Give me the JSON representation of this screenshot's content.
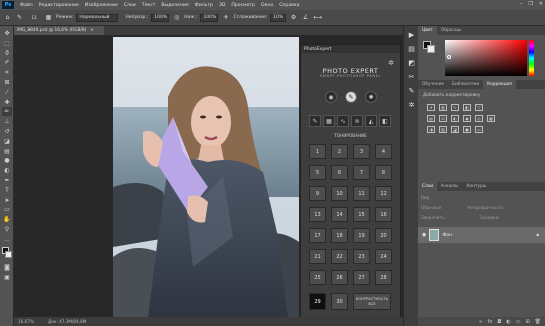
{
  "app": {
    "logo": "Ps",
    "menu": [
      "Файл",
      "Редактирование",
      "Изображение",
      "Слои",
      "Текст",
      "Выделение",
      "Фильтр",
      "3D",
      "Просмотр",
      "Окно",
      "Справка"
    ],
    "window_controls": [
      "–",
      "❐",
      "✕"
    ]
  },
  "options": {
    "mode_label": "Режим:",
    "mode_value": "Нормальный",
    "opacity_label": "Непрозр.:",
    "opacity_value": "100%",
    "flow_label": "Наж.:",
    "flow_value": "100%",
    "smooth_label": "Сглаживание:",
    "smooth_value": "10%",
    "brush_size": "13"
  },
  "document": {
    "tab_title": "IMG_8849.psd @ 16,6% (RGB/8)",
    "tab_close": "×",
    "zoom": "16,67%",
    "doc_info": "Док: 47,3M/84,8M"
  },
  "tools": [
    "move-icon",
    "marquee-icon",
    "lasso-icon",
    "quick-select-icon",
    "crop-icon",
    "frame-icon",
    "eyedropper-icon",
    "healing-icon",
    "brush-icon",
    "stamp-icon",
    "history-brush-icon",
    "eraser-icon",
    "gradient-icon",
    "blur-icon",
    "dodge-icon",
    "pen-icon",
    "type-icon",
    "path-select-icon",
    "shape-icon",
    "hand-icon",
    "zoom-icon",
    "more-icon"
  ],
  "plugin": {
    "title": "PhotoExpert",
    "logo_line1": "PHOTO EXPERT",
    "logo_line2": "SMART PHOTOSHOP PANEL",
    "section_label": "ТОНИРОВАНИЕ",
    "numbers": [
      "1",
      "2",
      "3",
      "4",
      "5",
      "6",
      "7",
      "8",
      "9",
      "10",
      "11",
      "12",
      "13",
      "14",
      "15",
      "16",
      "17",
      "18",
      "19",
      "20",
      "21",
      "22",
      "23",
      "24",
      "25",
      "26",
      "27",
      "28",
      "29",
      "30"
    ],
    "active": "29",
    "last_button": "КОНТРАСТНОСТЬ ВСЕ"
  },
  "right": {
    "color_tabs": [
      "Цвет",
      "Образцы"
    ],
    "adj_tabs": [
      "Обучение",
      "Библиотеки",
      "Коррекция"
    ],
    "adj_hint": "Добавить корректировку",
    "layer_tabs": [
      "Слои",
      "Каналы",
      "Контуры"
    ],
    "layer_kind": "Вид",
    "blend": "Обычные",
    "opacity_label": "Непрозрачность:",
    "lock_label": "Закрепить:",
    "fill_label": "Заливка:",
    "layer_name": "Фон"
  },
  "colors": {
    "accent": "#31a8ff",
    "bg": "#282828",
    "panel": "#535353"
  }
}
